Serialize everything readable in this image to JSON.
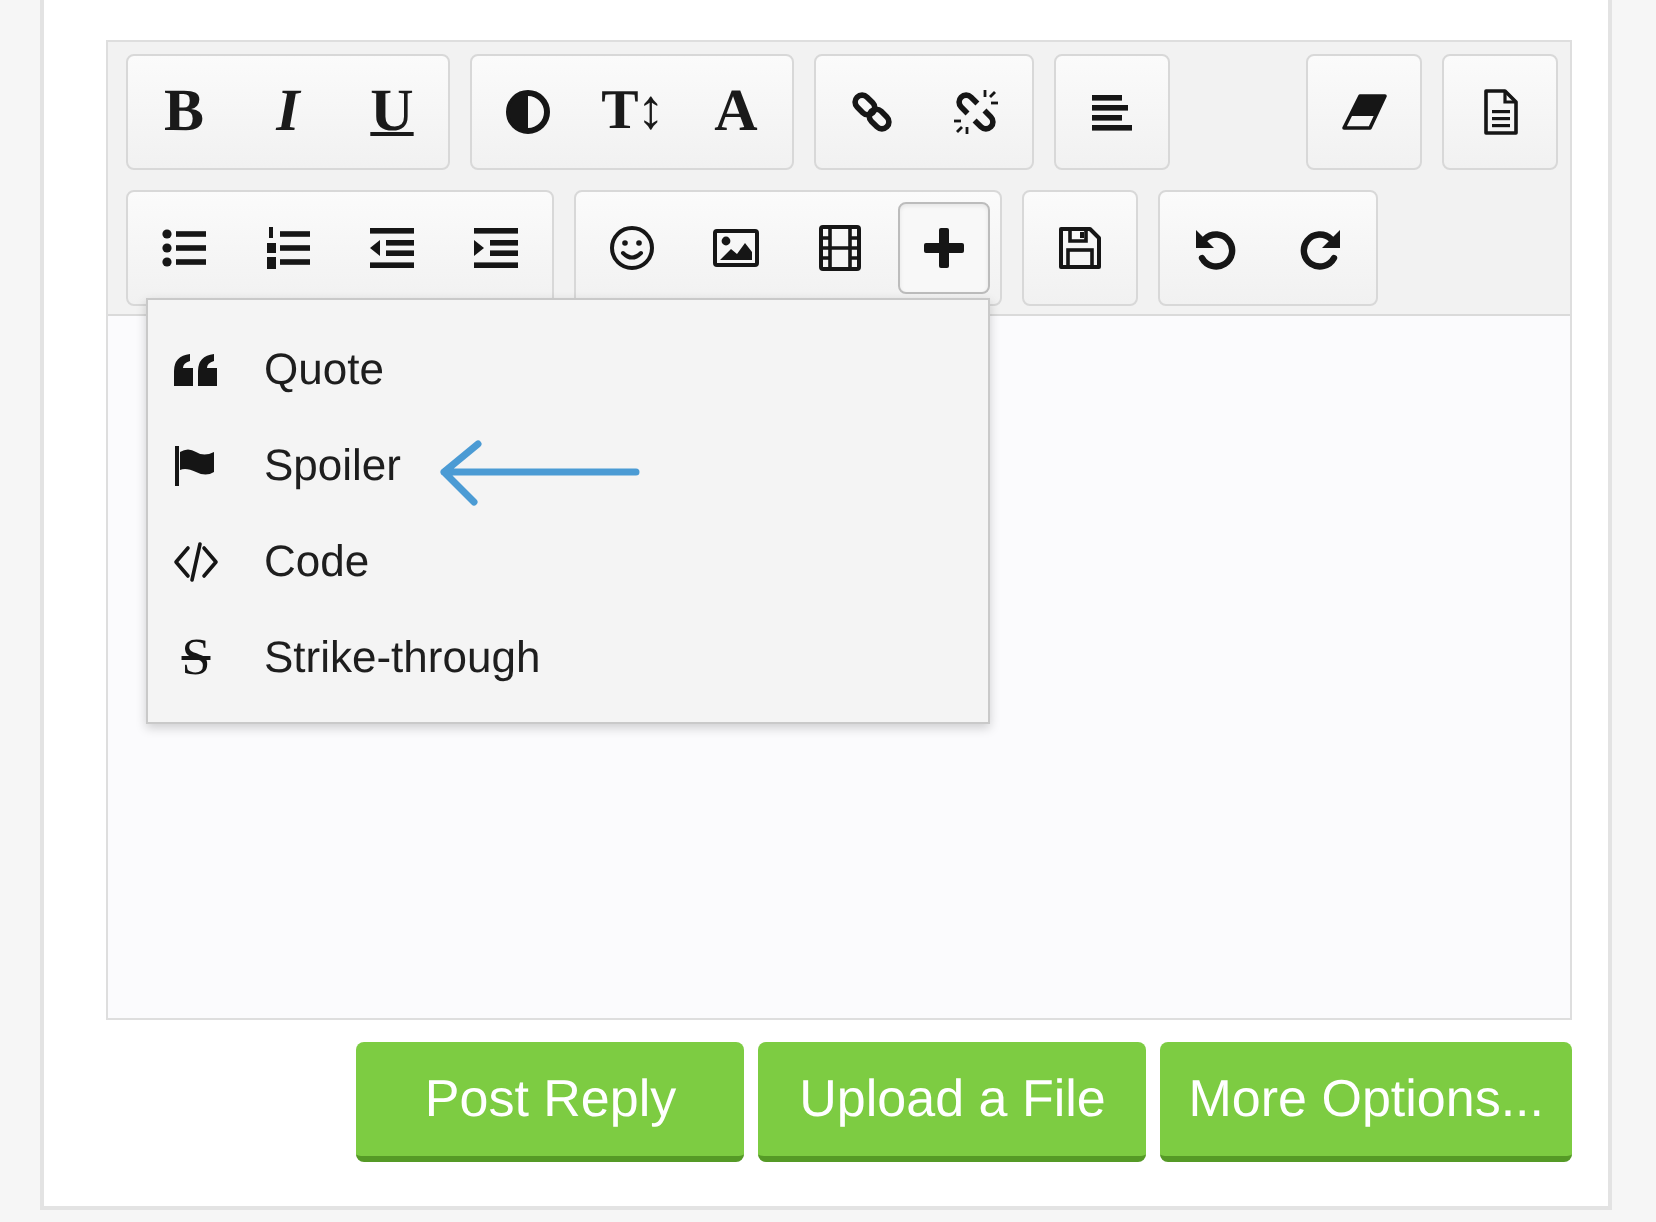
{
  "toolbar": {
    "rows": [
      {
        "groups": [
          {
            "buttons": [
              {
                "kind": "bold",
                "label": "B",
                "active": false
              },
              {
                "kind": "italic",
                "label": "I",
                "active": false
              },
              {
                "kind": "underline",
                "label": "U",
                "active": false
              }
            ]
          },
          {
            "buttons": [
              {
                "kind": "contrast",
                "active": false
              },
              {
                "kind": "text-size",
                "label": "T↕",
                "active": false
              },
              {
                "kind": "font",
                "label": "A",
                "active": false
              }
            ]
          },
          {
            "buttons": [
              {
                "kind": "link",
                "active": false
              },
              {
                "kind": "unlink",
                "active": false
              }
            ]
          },
          {
            "buttons": [
              {
                "kind": "align",
                "active": false
              }
            ]
          }
        ],
        "right_groups": [
          {
            "buttons": [
              {
                "kind": "eraser",
                "active": false
              }
            ]
          },
          {
            "buttons": [
              {
                "kind": "document",
                "active": false
              }
            ]
          }
        ]
      },
      {
        "groups": [
          {
            "buttons": [
              {
                "kind": "bullet-list",
                "active": false
              },
              {
                "kind": "numbered-list",
                "active": false
              },
              {
                "kind": "outdent",
                "active": false
              },
              {
                "kind": "indent",
                "active": false
              }
            ]
          },
          {
            "buttons": [
              {
                "kind": "emoji",
                "active": false
              },
              {
                "kind": "image",
                "active": false
              },
              {
                "kind": "video",
                "active": false
              },
              {
                "kind": "insert",
                "active": true
              }
            ]
          },
          {
            "buttons": [
              {
                "kind": "save",
                "active": false
              }
            ]
          },
          {
            "buttons": [
              {
                "kind": "undo",
                "active": false
              },
              {
                "kind": "redo",
                "active": false
              }
            ]
          }
        ]
      }
    ]
  },
  "insert_menu": {
    "items": [
      {
        "kind": "quote",
        "label": "Quote",
        "pointed_at": false
      },
      {
        "kind": "spoiler",
        "label": "Spoiler",
        "pointed_at": true
      },
      {
        "kind": "code",
        "label": "Code",
        "pointed_at": false
      },
      {
        "kind": "strike",
        "icon_glyph": "S",
        "label": "Strike-through",
        "pointed_at": false
      }
    ]
  },
  "buttons": [
    "Post Reply",
    "Upload a File",
    "More Options..."
  ]
}
